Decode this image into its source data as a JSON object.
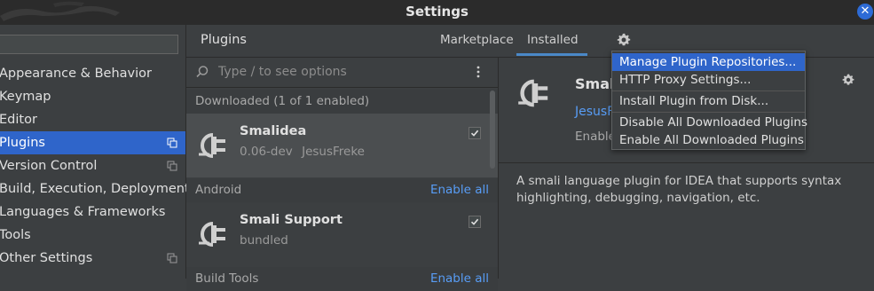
{
  "window": {
    "title": "Settings"
  },
  "sidebar": {
    "items": [
      {
        "label": "Appearance & Behavior",
        "selected": false,
        "copy_icon": false
      },
      {
        "label": "Keymap",
        "selected": false,
        "copy_icon": false
      },
      {
        "label": "Editor",
        "selected": false,
        "copy_icon": false
      },
      {
        "label": "Plugins",
        "selected": true,
        "copy_icon": true
      },
      {
        "label": "Version Control",
        "selected": false,
        "copy_icon": true
      },
      {
        "label": "Build, Execution, Deployment",
        "selected": false,
        "copy_icon": false
      },
      {
        "label": "Languages & Frameworks",
        "selected": false,
        "copy_icon": false
      },
      {
        "label": "Tools",
        "selected": false,
        "copy_icon": false
      },
      {
        "label": "Other Settings",
        "selected": false,
        "copy_icon": true
      }
    ]
  },
  "header": {
    "title": "Plugins",
    "tabs": [
      {
        "label": "Marketplace",
        "active": false
      },
      {
        "label": "Installed",
        "active": true
      }
    ]
  },
  "plugin_list": {
    "search_placeholder": "Type / to see options",
    "groups": [
      {
        "label": "Downloaded (1 of 1 enabled)",
        "action": ""
      },
      {
        "label": "Android",
        "action": "Enable all"
      },
      {
        "label": "Build Tools",
        "action": "Enable all"
      }
    ],
    "plugins": [
      {
        "name": "Smalidea",
        "version": "0.06-dev",
        "vendor": "JesusFreke",
        "checked": true
      },
      {
        "name": "Smali Support",
        "version": "bundled",
        "vendor": "",
        "checked": true
      }
    ]
  },
  "details": {
    "name": "Smal",
    "vendor": "JesusFr",
    "status": "Enable",
    "description": "A smali language plugin for IDEA that supports syntax highlighting, debugging, navigation, etc."
  },
  "menu": {
    "items": [
      {
        "label": "Manage Plugin Repositories...",
        "active": true
      },
      {
        "label": "HTTP Proxy Settings...",
        "active": false
      },
      {
        "label": "Install Plugin from Disk...",
        "active": false
      },
      {
        "label": "Disable All Downloaded Plugins",
        "active": false
      },
      {
        "label": "Enable All Downloaded Plugins",
        "active": false
      }
    ]
  },
  "colors": {
    "accent": "#2f65ca",
    "link": "#589df6",
    "background": "#3c3f41",
    "titlebar": "#2b2b2b"
  }
}
